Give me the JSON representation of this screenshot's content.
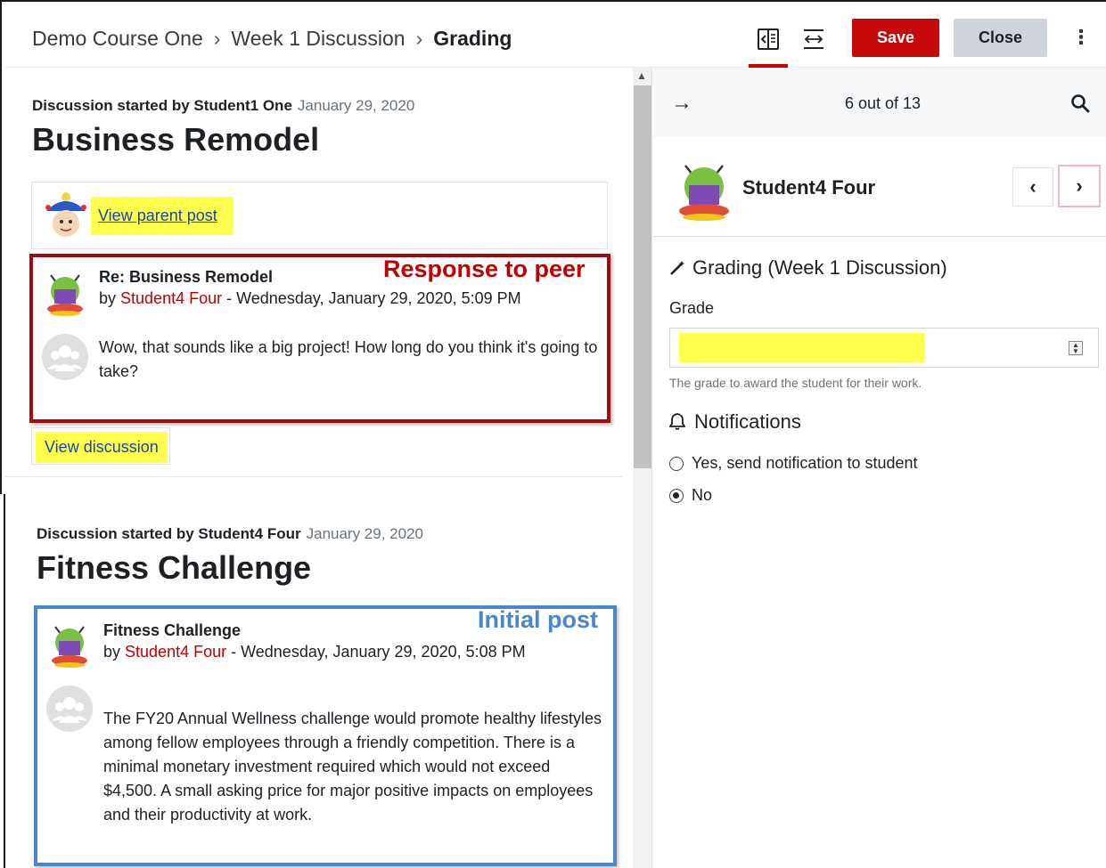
{
  "breadcrumb": {
    "course": "Demo Course One",
    "activity": "Week 1 Discussion",
    "current": "Grading",
    "separator": "›"
  },
  "toolbar": {
    "collapse_grader_icon": "collapse-grader-icon",
    "expand_view_icon": "expand-view-icon",
    "save_label": "Save",
    "close_label": "Close",
    "more_icon": "⋮"
  },
  "discussions": [
    {
      "started_by": "Discussion started by Student1 One",
      "date": "January 29, 2020",
      "title": "Business Remodel",
      "parent_link": "View parent post",
      "annotation": "Response to peer",
      "post": {
        "subject": "Re: Business Remodel",
        "by_prefix": "by",
        "author": "Student4 Four",
        "timestamp": " - Wednesday, January 29, 2020, 5:09 PM",
        "message": "Wow, that sounds like a big project! How long do you think it's going to take?"
      },
      "view_discussion": "View discussion"
    },
    {
      "started_by": "Discussion started by Student4 Four",
      "date": "January 29, 2020",
      "title": "Fitness Challenge",
      "annotation": "Initial post",
      "post": {
        "subject": "Fitness Challenge",
        "by_prefix": "by",
        "author": "Student4 Four",
        "timestamp": " - Wednesday, January 29, 2020, 5:08 PM",
        "message": "The FY20 Annual Wellness challenge would promote healthy lifestyles among fellow employees through a friendly competition. There is a minimal monetary investment required which would not exceed $4,500. A small asking price for major positive impacts on employees and their productivity at work."
      }
    }
  ],
  "grader": {
    "nav_arrow": "→",
    "count": "6 out of 13",
    "student_name": "Student4 Four",
    "prev": "‹",
    "next": "›",
    "grading_title": "Grading (Week 1 Discussion)",
    "grade_label": "Grade",
    "grade_value": "",
    "grade_help": "The grade to award the student for their work.",
    "notifications_title": "Notifications",
    "notify_yes": "Yes, send notification to student",
    "notify_no": "No",
    "notify_selected": "No"
  },
  "colors": {
    "brand_red": "#c60a0a",
    "highlight": "#ffff4d",
    "annotation_red": "#9e0b10",
    "annotation_blue": "#4a86c8",
    "link": "#0f47ad"
  }
}
